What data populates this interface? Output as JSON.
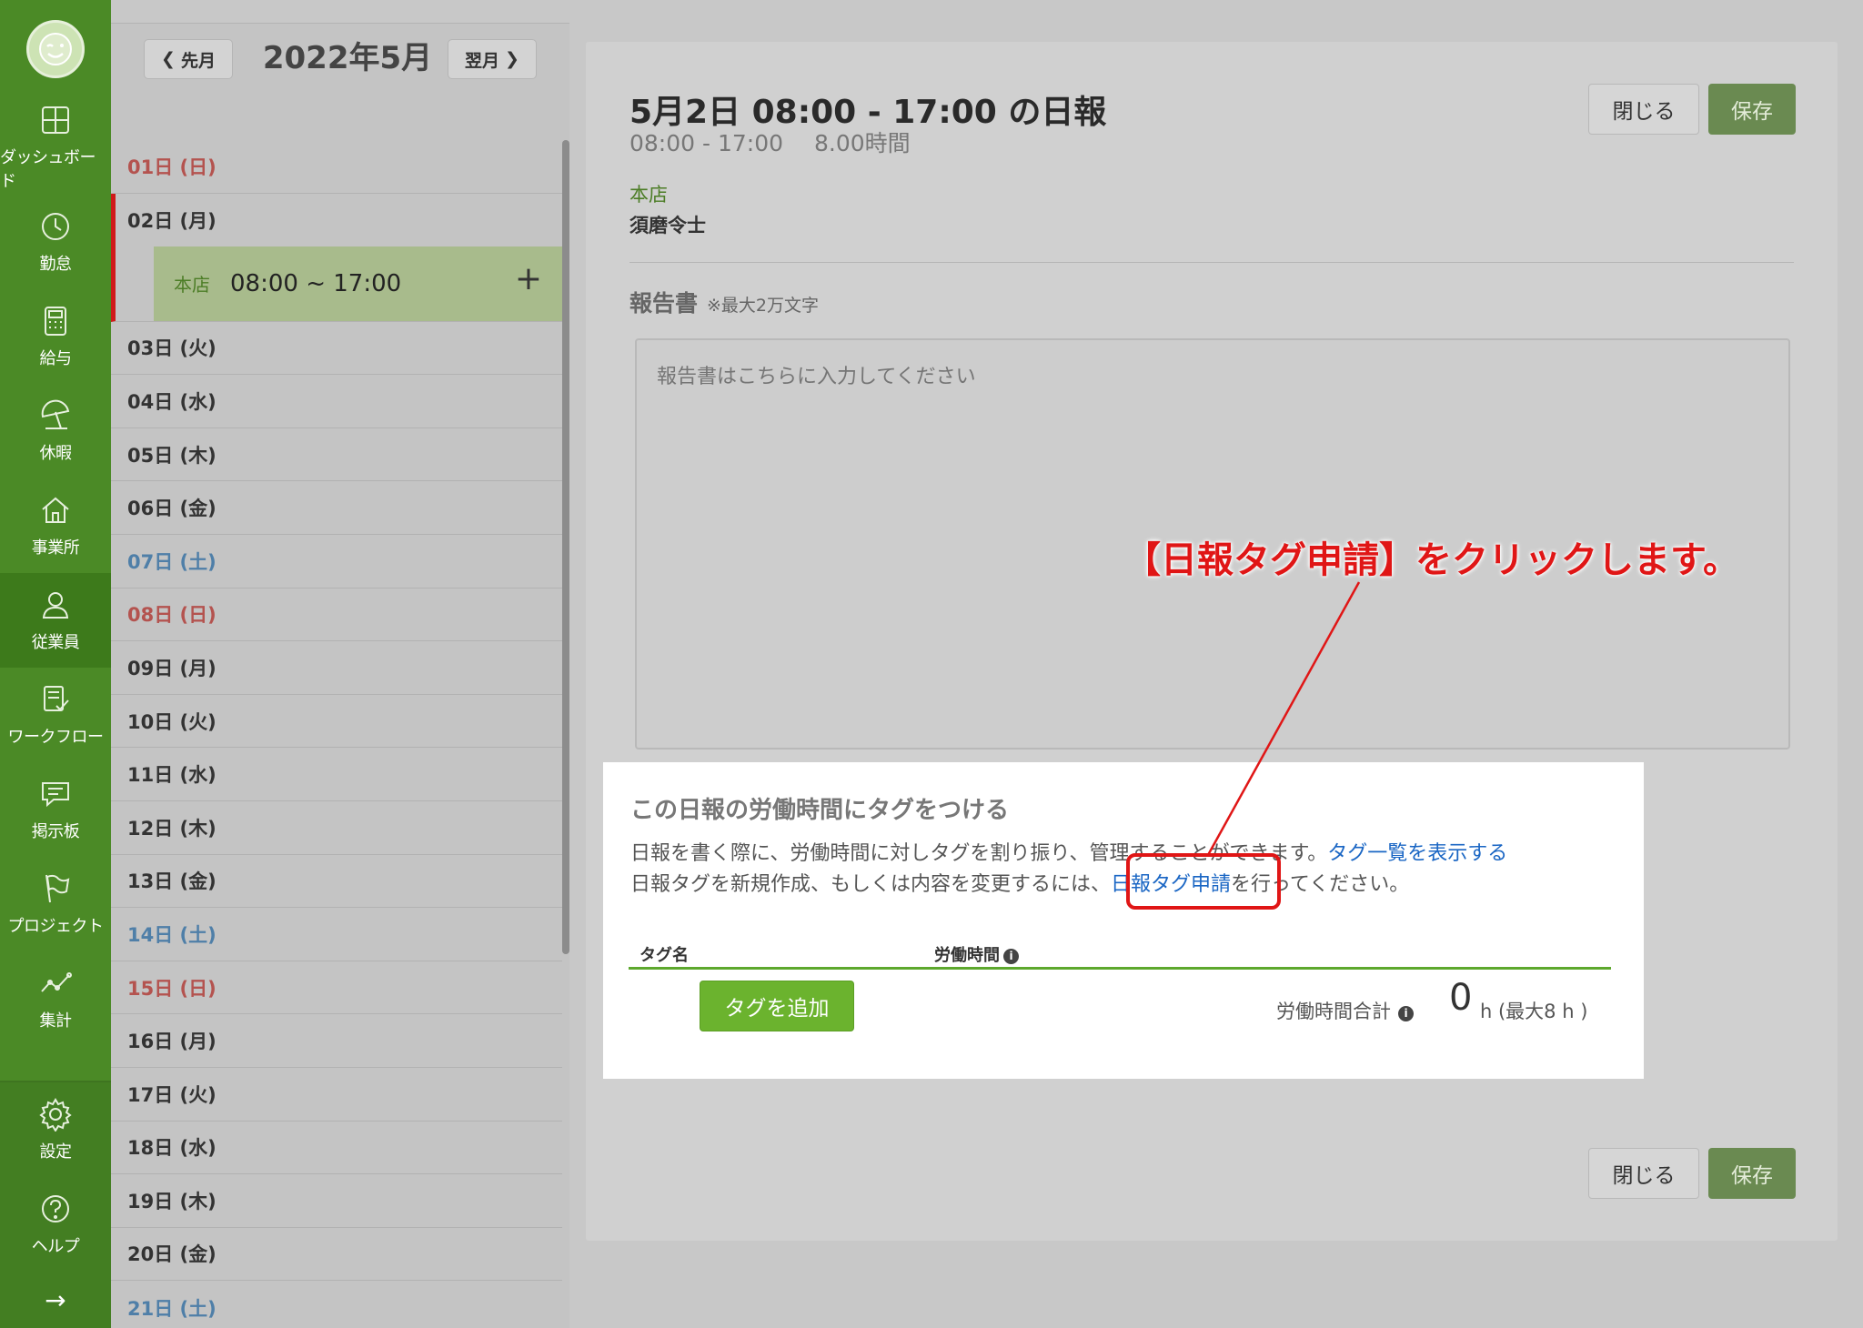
{
  "sidebar": {
    "items": [
      {
        "label": "ダッシュボード",
        "icon": "dashboard-icon"
      },
      {
        "label": "勤怠",
        "icon": "clock-icon"
      },
      {
        "label": "給与",
        "icon": "calculator-icon"
      },
      {
        "label": "休暇",
        "icon": "parasol-icon"
      },
      {
        "label": "事業所",
        "icon": "house-icon"
      },
      {
        "label": "従業員",
        "icon": "person-icon"
      },
      {
        "label": "ワークフロー",
        "icon": "checklist-icon"
      },
      {
        "label": "掲示板",
        "icon": "message-icon"
      },
      {
        "label": "プロジェクト",
        "icon": "flag-icon"
      },
      {
        "label": "集計",
        "icon": "line-chart-icon"
      }
    ],
    "bottom_items": [
      {
        "label": "設定",
        "icon": "gear-icon"
      },
      {
        "label": "ヘルプ",
        "icon": "help-icon"
      }
    ],
    "expand_arrow": "→"
  },
  "calendar": {
    "prev_label": "先月",
    "next_label": "翌月",
    "month_title": "2022年5月",
    "days": [
      {
        "label": "01日 (日)",
        "type": "sun"
      },
      {
        "label": "02日 (月)",
        "type": "weekday",
        "expanded": true
      },
      {
        "label": "03日 (火)",
        "type": "weekday"
      },
      {
        "label": "04日 (水)",
        "type": "weekday"
      },
      {
        "label": "05日 (木)",
        "type": "weekday"
      },
      {
        "label": "06日 (金)",
        "type": "weekday"
      },
      {
        "label": "07日 (土)",
        "type": "sat"
      },
      {
        "label": "08日 (日)",
        "type": "sun"
      },
      {
        "label": "09日 (月)",
        "type": "weekday"
      },
      {
        "label": "10日 (火)",
        "type": "weekday"
      },
      {
        "label": "11日 (水)",
        "type": "weekday"
      },
      {
        "label": "12日 (木)",
        "type": "weekday"
      },
      {
        "label": "13日 (金)",
        "type": "weekday"
      },
      {
        "label": "14日 (土)",
        "type": "sat"
      },
      {
        "label": "15日 (日)",
        "type": "sun"
      },
      {
        "label": "16日 (月)",
        "type": "weekday"
      },
      {
        "label": "17日 (火)",
        "type": "weekday"
      },
      {
        "label": "18日 (水)",
        "type": "weekday"
      },
      {
        "label": "19日 (木)",
        "type": "weekday"
      },
      {
        "label": "20日 (金)",
        "type": "weekday"
      },
      {
        "label": "21日 (土)",
        "type": "sat"
      }
    ],
    "shift": {
      "store": "本店",
      "time": "08:00 ~ 17:00",
      "add": "+"
    }
  },
  "report": {
    "title": "5月2日 08:00 - 17:00 の日報",
    "time_range": "08:00 - 17:00",
    "hours": "8.00時間",
    "close_label": "閉じる",
    "save_label": "保存",
    "store": "本店",
    "staff": "須磨令士",
    "report_label": "報告書",
    "report_note": "※最大2万文字",
    "report_placeholder": "報告書はこちらに入力してください"
  },
  "tag_section": {
    "title": "この日報の労働時間にタグをつける",
    "desc1_text": "日報を書く際に、労働時間に対しタグを割り振り、管理することができます。",
    "desc1_link": "タグ一覧を表示する",
    "desc2_pre": "日報タグを新規作成、もしくは内容を変更するには、",
    "desc2_link": "日報タグ申請",
    "desc2_post": "を行ってください。",
    "col_tag": "タグ名",
    "col_hours": "労働時間",
    "add_button": "タグを追加",
    "total_label": "労働時間合計",
    "total_value": "0",
    "total_unit": "h (最大8 h )"
  },
  "annotation": {
    "text": "【日報タグ申請】をクリックします。",
    "color": "#e01616"
  },
  "colors": {
    "sidebar": "#4b8a26",
    "accent": "#6bb32e",
    "link": "#1a66c4",
    "sunday": "#b4534f",
    "saturday": "#4f7fa8"
  }
}
